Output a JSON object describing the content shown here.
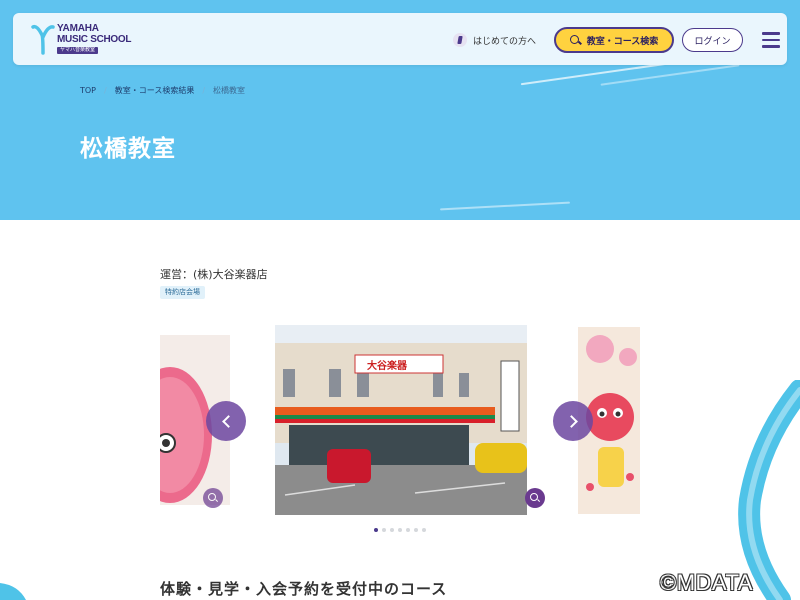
{
  "header": {
    "logo_line1": "YAMAHA",
    "logo_line2": "MUSIC SCHOOL",
    "logo_sub": "ヤマハ音楽教室",
    "first_time_label": "はじめての方へ",
    "search_label": "教室・コース検索",
    "login_label": "ログイン",
    "icons": [
      "yamaha-logo-icon",
      "first-visit-icon",
      "search-icon",
      "hamburger-menu-icon"
    ]
  },
  "breadcrumb": {
    "top": "TOP",
    "search_results": "教室・コース検索結果",
    "current": "松橋教室",
    "separator": "/"
  },
  "page": {
    "title": "松橋教室",
    "operator": "運営：(株)大谷楽器店",
    "tag": "特約店会場",
    "section_heading": "体験・見学・入会予約を受付中のコース"
  },
  "carousel": {
    "slide_count": 7,
    "active_index": 0,
    "store_sign": "大谷楽器"
  },
  "watermark": "©MDATA",
  "colors": {
    "hero_bg": "#5fc3ef",
    "brand_purple": "#4b3a8c",
    "search_yellow": "#ffd23f"
  }
}
